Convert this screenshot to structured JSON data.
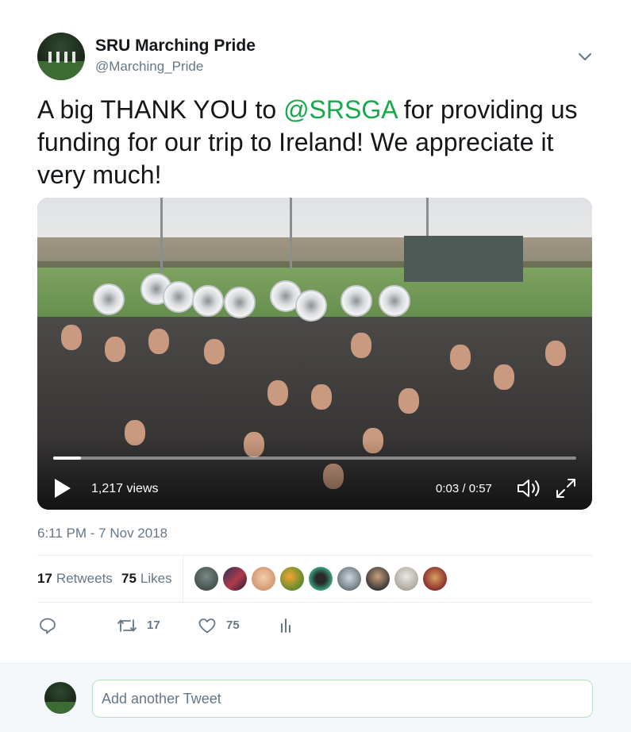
{
  "author": {
    "name": "SRU Marching Pride",
    "handle": "@Marching_Pride"
  },
  "menu_icon": "chevron-down-icon",
  "tweet": {
    "text_before": "A big THANK YOU to ",
    "mention": "@SRSGA",
    "text_after": " for providing us funding for our trip to Ireland! We appreciate it very much!"
  },
  "video": {
    "views": "1,217 views",
    "time": "0:03 / 0:57",
    "progress_fraction": 0.053,
    "icons": [
      "play-icon",
      "volume-icon",
      "fullscreen-icon"
    ]
  },
  "timestamp": "6:11 PM - 7 Nov 2018",
  "stats": {
    "retweets_count": "17",
    "retweets_label": "Retweets",
    "likes_count": "75",
    "likes_label": "Likes"
  },
  "actions": {
    "retweet_count": "17",
    "like_count": "75",
    "icons": [
      "reply-icon",
      "retweet-icon",
      "heart-icon",
      "analytics-icon"
    ]
  },
  "reply": {
    "placeholder": "Add another Tweet"
  },
  "colors": {
    "mention": "#17a84a",
    "secondary_text": "#657786",
    "divider": "#e6ecf0",
    "reply_border": "#b6e0c1"
  }
}
